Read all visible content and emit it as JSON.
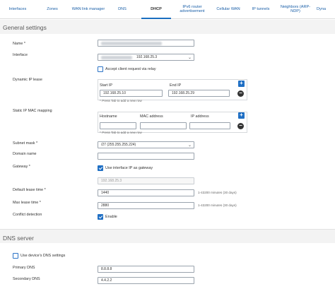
{
  "tabs": [
    {
      "label": "Interfaces"
    },
    {
      "label": "Zones"
    },
    {
      "label": "WAN link manager"
    },
    {
      "label": "DNS"
    },
    {
      "label": "DHCP"
    },
    {
      "label": "IPv6 router advertisement"
    },
    {
      "label": "Cellular WAN"
    },
    {
      "label": "IP tunnels"
    },
    {
      "label": "Neighbors (ARP-NDP)"
    },
    {
      "label": "Dyna"
    }
  ],
  "general": {
    "title": "General settings",
    "name_label": "Name *",
    "interface_label": "Interface",
    "interface_value": "192.168.25.3",
    "relay_label": "Accept client request via relay",
    "dynamic_lease_label": "Dynamic IP lease",
    "start_ip_label": "Start IP",
    "end_ip_label": "End IP",
    "start_ip_value": "192.168.25.10",
    "end_ip_value": "192.168.25.29",
    "hint": "* Press Tab to add a new row",
    "static_label": "Static IP MAC mapping",
    "hostname_label": "Hostname",
    "mac_label": "MAC address",
    "ip_label": "IP address",
    "subnet_label": "Subnet mask *",
    "subnet_value": "/27 (255.255.255.224)",
    "domain_label": "Domain name",
    "gateway_label": "Gateway *",
    "use_iface_gateway_label": "Use interface IP as gateway",
    "gateway_value": "192.168.25.3",
    "default_lease_label": "Default lease time *",
    "default_lease_value": "1440",
    "lease_note": "1-43200 minutes (30 days)",
    "max_lease_label": "Max lease time *",
    "max_lease_value": "2880",
    "conflict_label": "Conflict detection",
    "enable_label": "Enable"
  },
  "dns": {
    "title": "DNS server",
    "use_device_label": "Use device's DNS settings",
    "primary_label": "Primary DNS",
    "primary_value": "8.8.8.8",
    "secondary_label": "Secondary DNS",
    "secondary_value": "4.4.2.2"
  }
}
